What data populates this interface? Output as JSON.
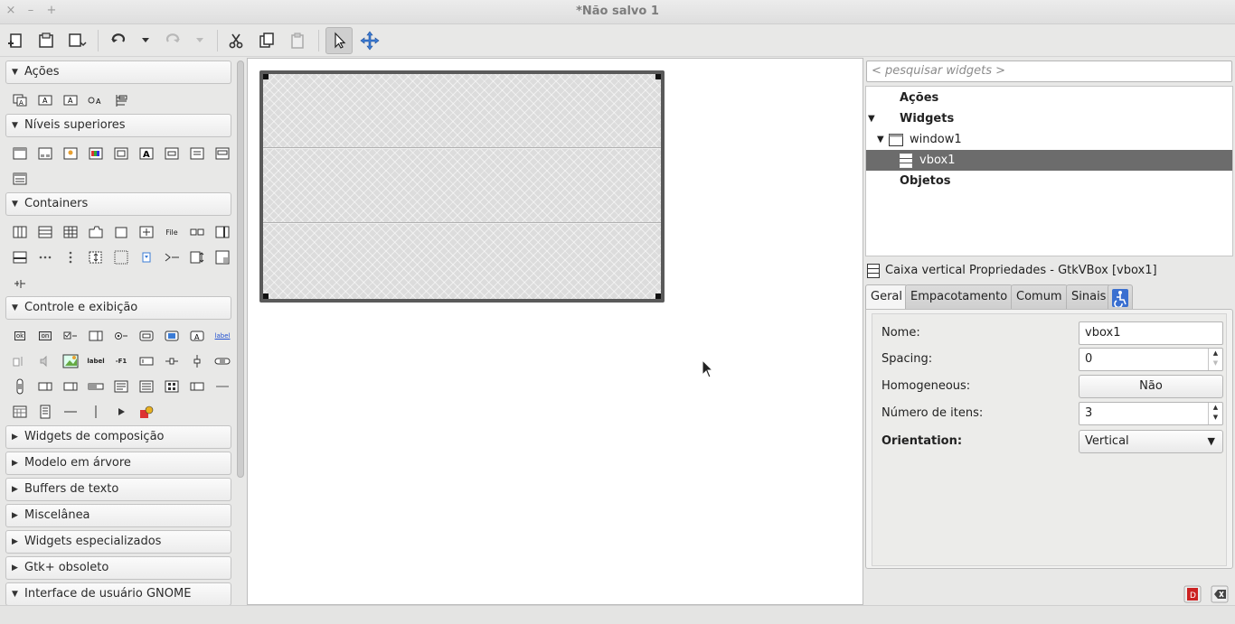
{
  "window": {
    "title": "*Não salvo 1",
    "controls": {
      "close": "×",
      "minimize": "–",
      "maximize": "+"
    }
  },
  "toolbar": {
    "items": [
      {
        "name": "new-icon"
      },
      {
        "name": "open-icon"
      },
      {
        "name": "save-icon"
      },
      {
        "name": "undo-icon"
      },
      {
        "name": "undo-menu-icon"
      },
      {
        "name": "redo-icon"
      },
      {
        "name": "redo-menu-icon"
      },
      {
        "name": "cut-icon"
      },
      {
        "name": "copy-icon"
      },
      {
        "name": "paste-icon"
      },
      {
        "name": "select-pointer-icon",
        "active": true
      },
      {
        "name": "drag-resize-icon"
      }
    ]
  },
  "palette": {
    "sections": [
      {
        "label": "Ações",
        "expanded": true
      },
      {
        "label": "Níveis superiores",
        "expanded": true
      },
      {
        "label": "Containers",
        "expanded": true
      },
      {
        "label": "Controle e exibição",
        "expanded": true
      },
      {
        "label": "Widgets de composição",
        "expanded": false
      },
      {
        "label": "Modelo em árvore",
        "expanded": false
      },
      {
        "label": "Buffers de texto",
        "expanded": false
      },
      {
        "label": "Miscelânea",
        "expanded": false
      },
      {
        "label": "Widgets especializados",
        "expanded": false
      },
      {
        "label": "Gtk+ obsoleto",
        "expanded": false
      },
      {
        "label": "Interface de usuário GNOME",
        "expanded": true
      }
    ],
    "icon_text": {
      "file": "File",
      "label": "label",
      "label2": "label",
      "f1": "-F1",
      "ok": "ok",
      "on": "on"
    }
  },
  "search": {
    "placeholder": "< pesquisar widgets >"
  },
  "tree": {
    "items": [
      {
        "label": "Ações",
        "level": 0
      },
      {
        "label": "Widgets",
        "level": 0
      },
      {
        "label": "window1",
        "level": 1
      },
      {
        "label": "vbox1",
        "level": 2,
        "selected": true
      },
      {
        "label": "Objetos",
        "level": 0
      }
    ]
  },
  "properties": {
    "title": "Caixa vertical Propriedades - GtkVBox [vbox1]",
    "tabs": [
      "Geral",
      "Empacotamento",
      "Comum",
      "Sinais"
    ],
    "active_tab": "Geral",
    "accessibility_tab_icon": "accessibility-icon",
    "rows": {
      "name": {
        "label": "Nome:",
        "value": "vbox1"
      },
      "spacing": {
        "label": "Spacing:",
        "value": "0"
      },
      "homogeneous": {
        "label": "Homogeneous:",
        "value": "Não"
      },
      "items": {
        "label": "Número de itens:",
        "value": "3"
      },
      "orientation": {
        "label": "Orientation:",
        "value": "Vertical"
      }
    }
  },
  "colors": {
    "selection": "#6c6c6c",
    "toolbar_move_icon": "#3a7bd5"
  }
}
